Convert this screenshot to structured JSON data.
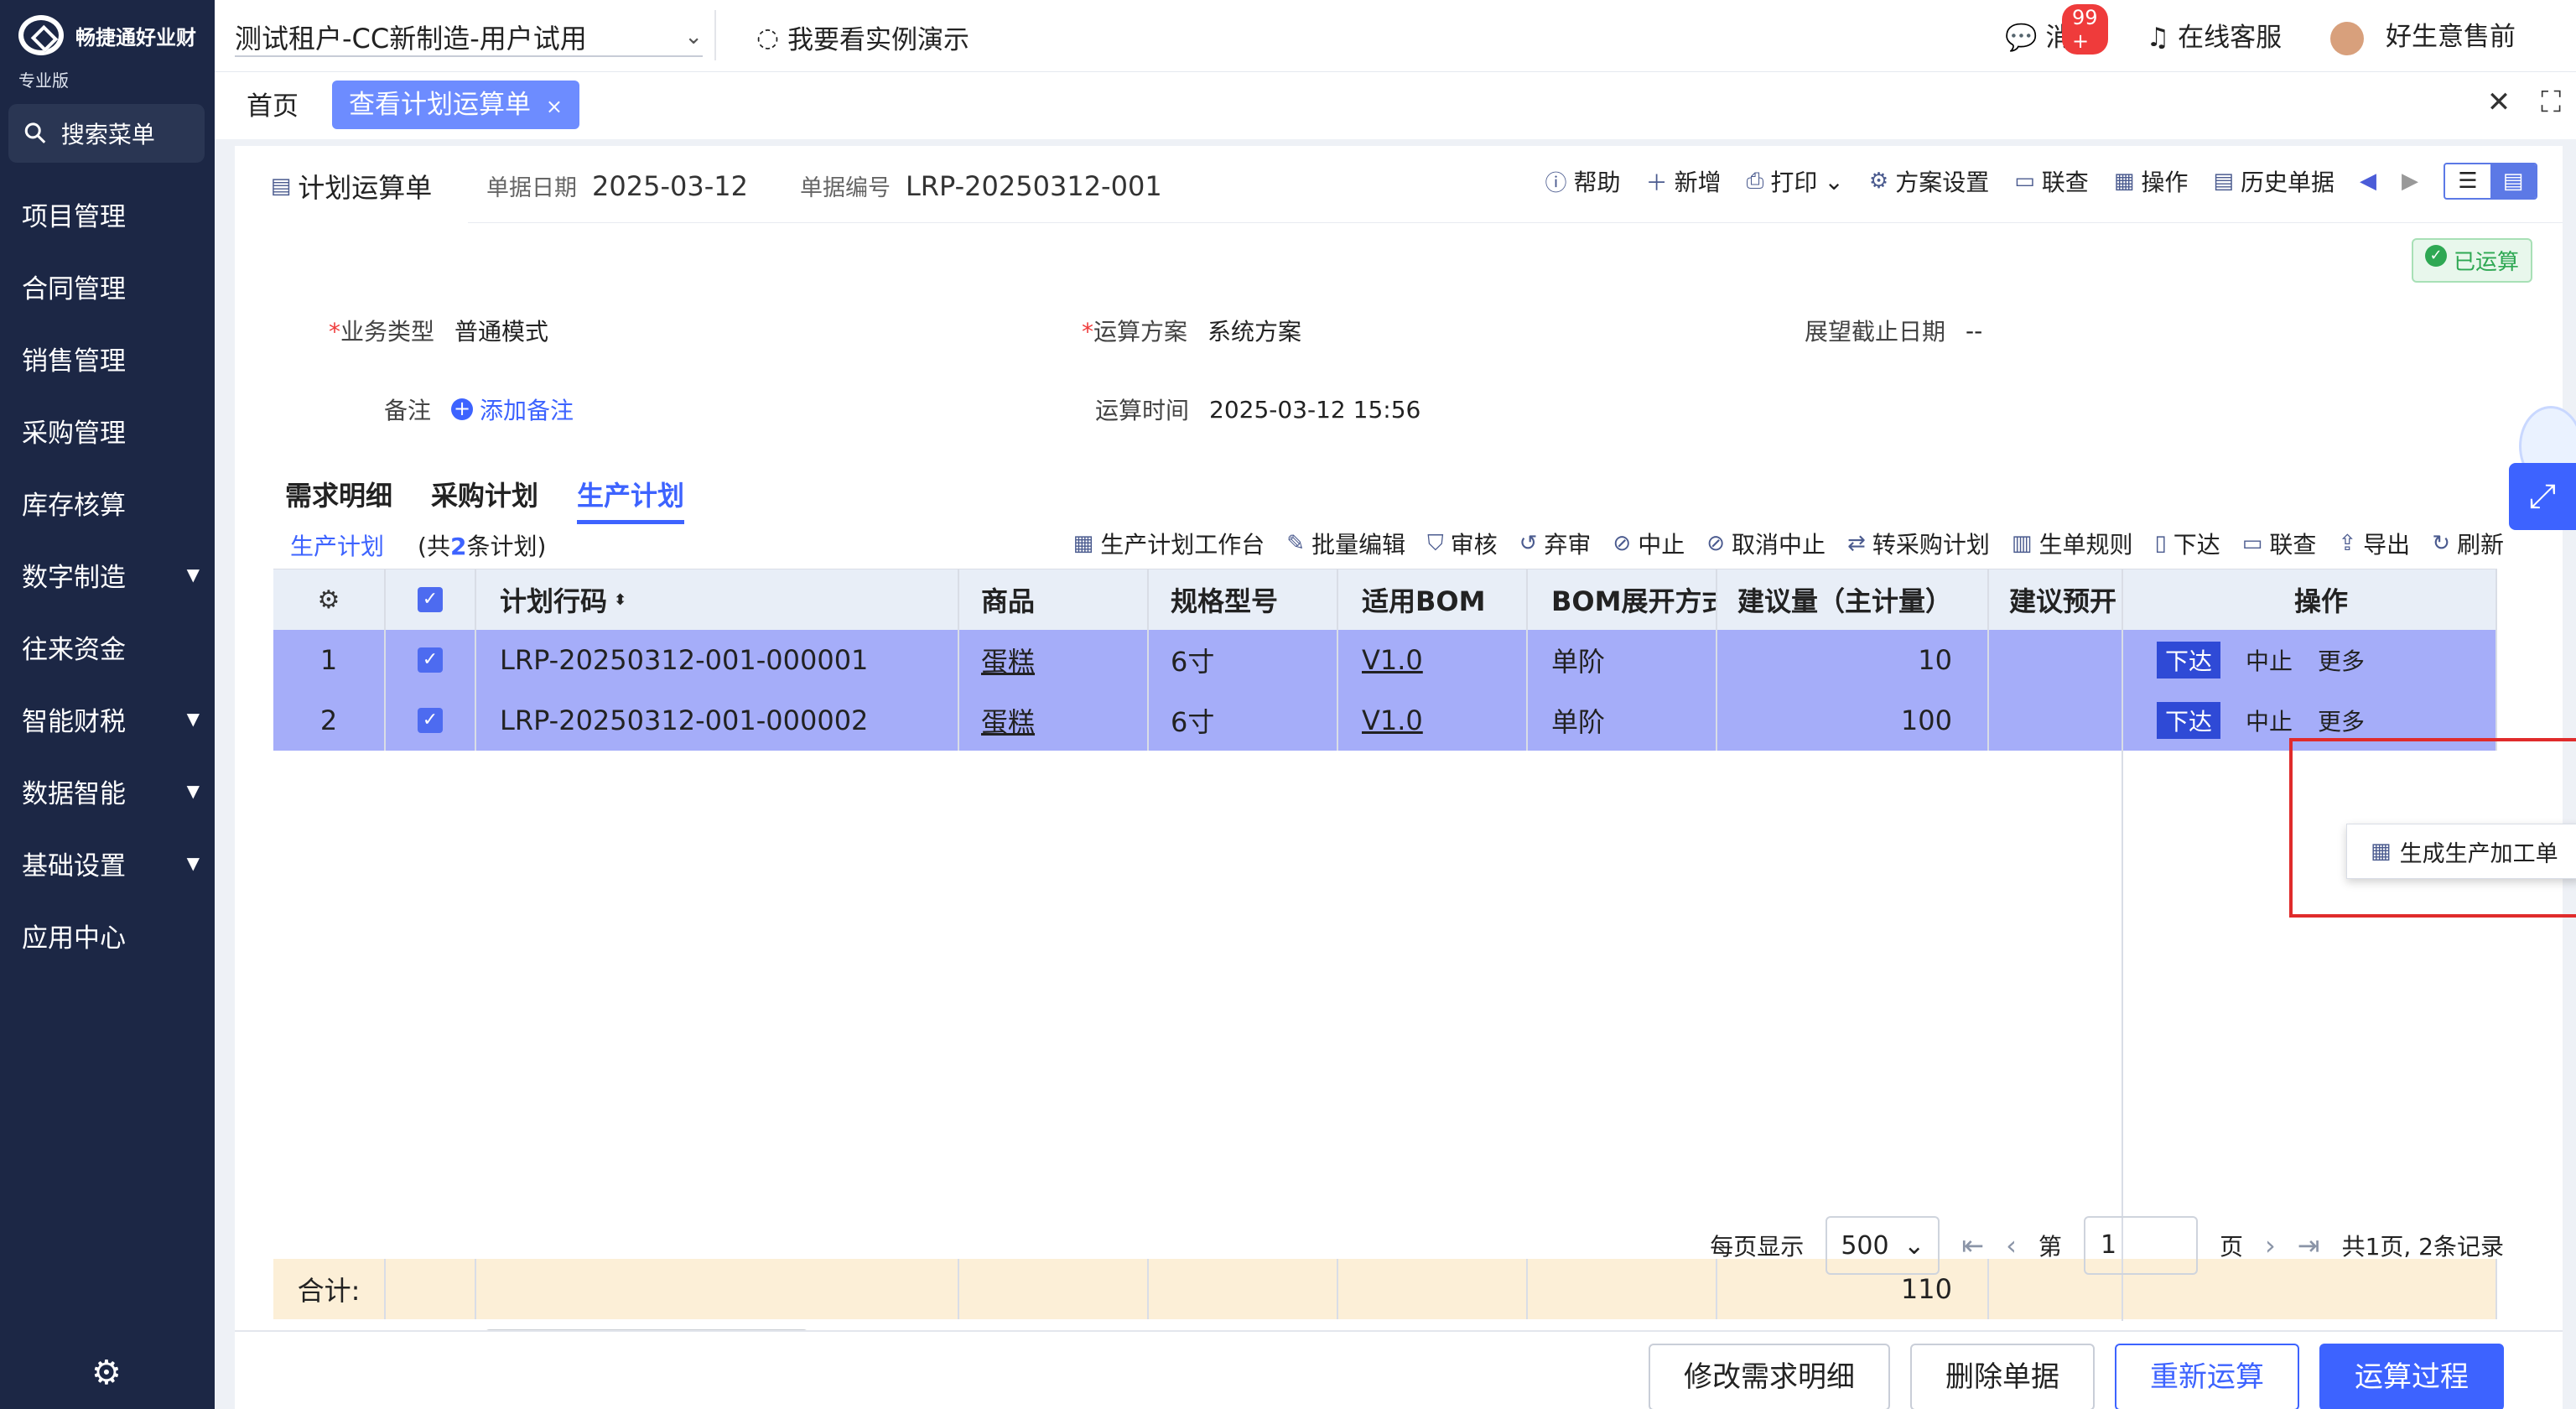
{
  "sidebar": {
    "brand": "畅捷通好业财",
    "edition": "专业版",
    "search_label": "搜索菜单",
    "items": [
      {
        "label": "项目管理",
        "arrow": ""
      },
      {
        "label": "合同管理",
        "arrow": ""
      },
      {
        "label": "销售管理",
        "arrow": ""
      },
      {
        "label": "采购管理",
        "arrow": ""
      },
      {
        "label": "库存核算",
        "arrow": ""
      },
      {
        "label": "数字制造",
        "arrow": "▼"
      },
      {
        "label": "往来资金",
        "arrow": ""
      },
      {
        "label": "智能财税",
        "arrow": "▼"
      },
      {
        "label": "数据智能",
        "arrow": "▼"
      },
      {
        "label": "基础设置",
        "arrow": "▼"
      },
      {
        "label": "应用中心",
        "arrow": ""
      }
    ]
  },
  "topbar": {
    "tenant": "测试租户-CC新制造-用户试用",
    "demo": "我要看实例演示",
    "message": "消息",
    "message_badge": "99 +",
    "service": "在线客服",
    "user": "好生意售前"
  },
  "tabs": {
    "home": "首页",
    "active": "查看计划运算单"
  },
  "doc": {
    "tab": "计划运算单",
    "date_label": "单据日期",
    "date": "2025-03-12",
    "no_label": "单据编号",
    "no": "LRP-20250312-001",
    "status": "已运算",
    "tools": [
      "帮助",
      "新增",
      "打印",
      "方案设置",
      "联查",
      "操作",
      "历史单据"
    ]
  },
  "form": {
    "biz_type_label": "业务类型",
    "biz_type": "普通模式",
    "scheme_label": "运算方案",
    "scheme": "系统方案",
    "horizon_label": "展望截止日期",
    "horizon": "--",
    "remark_label": "备注",
    "add_remark": "添加备注",
    "run_time_label": "运算时间",
    "run_time": "2025-03-12 15:56"
  },
  "sub_tabs": [
    "需求明细",
    "采购计划",
    "生产计划"
  ],
  "list": {
    "title": "生产计划",
    "count_prefix": "(共",
    "count": "2",
    "count_suffix": "条计划)",
    "tools": [
      "生产计划工作台",
      "批量编辑",
      "审核",
      "弃审",
      "中止",
      "取消中止",
      "转采购计划",
      "生单规则",
      "下达",
      "联查",
      "导出",
      "刷新"
    ]
  },
  "table": {
    "headers": [
      "",
      "",
      "计划行码",
      "商品",
      "规格型号",
      "适用BOM",
      "BOM展开方式",
      "建议量（主计量）",
      "建议预开",
      "操作"
    ],
    "rows": [
      {
        "idx": "1",
        "code": "LRP-20250312-001-000001",
        "product": "蛋糕",
        "spec": "6寸",
        "bom": "V1.0",
        "expand": "单阶",
        "qty": "10",
        "op1": "下达",
        "op2": "中止",
        "op3": "更多"
      },
      {
        "idx": "2",
        "code": "LRP-20250312-001-000002",
        "product": "蛋糕",
        "spec": "6寸",
        "bom": "V1.0",
        "expand": "单阶",
        "qty": "100",
        "op1": "下达",
        "op2": "中止",
        "op3": "更多"
      }
    ],
    "sum_label": "合计:",
    "sum_qty": "110",
    "dropdown_item": "生成生产加工单"
  },
  "pager": {
    "per_page_label": "每页显示",
    "per_page": "500",
    "page_prefix": "第",
    "page": "1",
    "page_suffix": "页",
    "summary": "共1页, 2条记录"
  },
  "buttons": {
    "modify": "修改需求明细",
    "delete": "删除单据",
    "rerun": "重新运算",
    "process": "运算过程"
  }
}
